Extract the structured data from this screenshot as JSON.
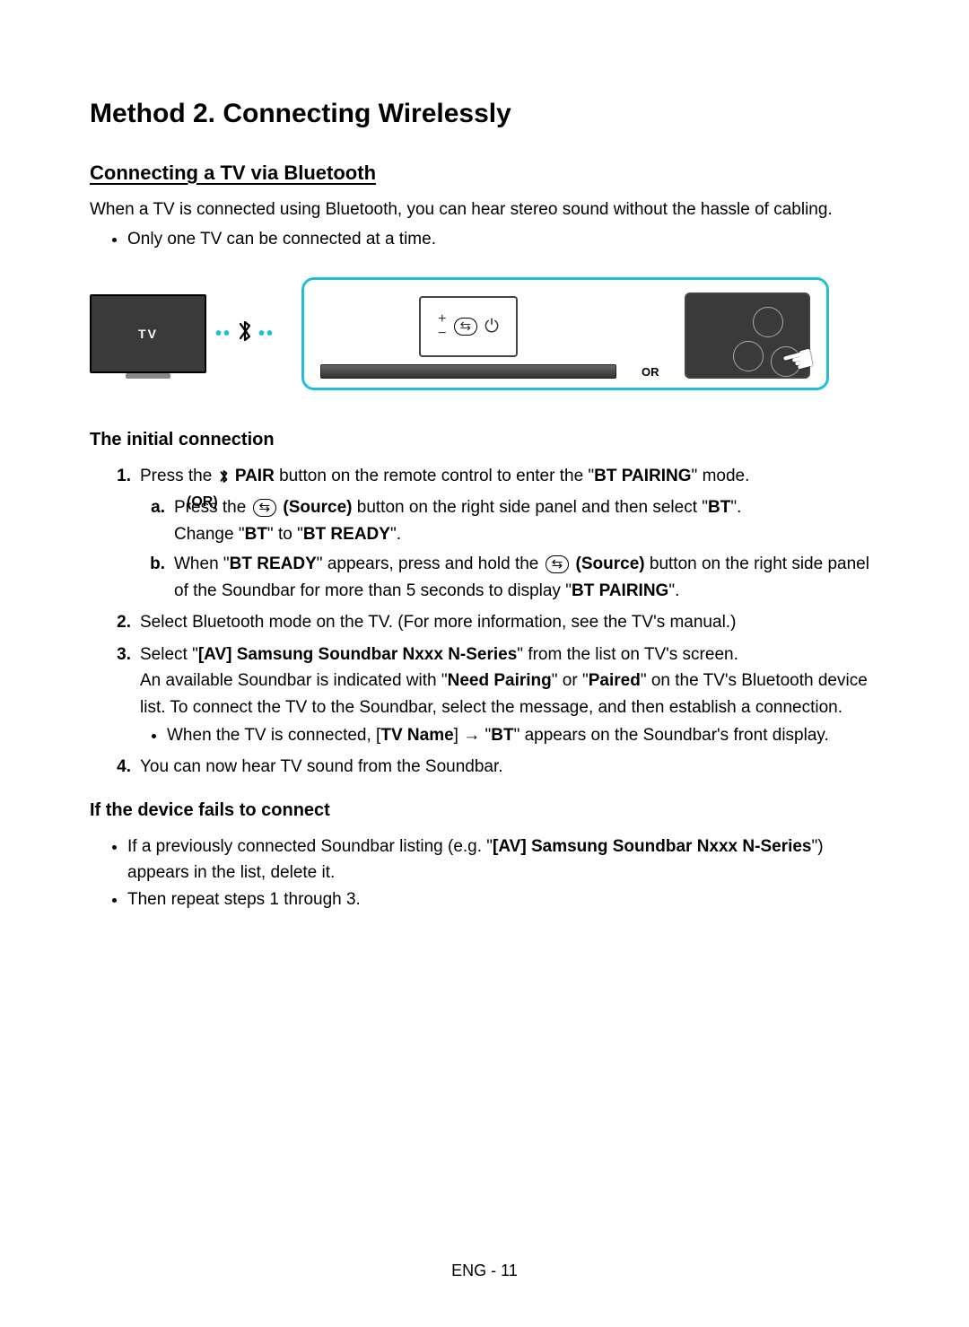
{
  "title": "Method 2. Connecting Wirelessly",
  "section": {
    "heading": "Connecting a TV via Bluetooth",
    "intro": "When a TV is connected using Bluetooth, you can hear stereo sound without the hassle of cabling.",
    "bullet": "Only one TV can be connected at a time."
  },
  "diagram": {
    "tv_label": "TV",
    "or_label": "OR",
    "panel_plus": "+",
    "panel_minus": "−",
    "panel_power": "⏻"
  },
  "initial": {
    "heading": "The initial connection",
    "step1": {
      "num": "1.",
      "t1": "Press the ",
      "pair": "PAIR",
      "t2": " button on the remote control to enter the \"",
      "bt_pairing": "BT PAIRING",
      "t3": "\" mode."
    },
    "or_label": "(OR)",
    "a": {
      "num": "a.",
      "t1": "Press the ",
      "source": "(Source)",
      "t2": " button on the right side panel and then select \"",
      "bt": "BT",
      "t3": "\".",
      "t4": "Change \"",
      "bt2": "BT",
      "t5": "\" to \"",
      "bt_ready": "BT READY",
      "t6": "\"."
    },
    "b": {
      "num": "b.",
      "t1": "When \"",
      "bt_ready": "BT READY",
      "t2": "\" appears, press and hold the ",
      "source": "(Source)",
      "t3": " button on the right side panel of the Soundbar for more than 5 seconds to display \"",
      "bt_pairing": "BT PAIRING",
      "t4": "\"."
    },
    "step2": {
      "num": "2.",
      "text": "Select Bluetooth mode on the TV. (For more information, see the TV's manual.)"
    },
    "step3": {
      "num": "3.",
      "t1": "Select \"",
      "device": "[AV] Samsung Soundbar Nxxx N-Series",
      "t2": "\" from the list on TV's screen.",
      "t3": "An available Soundbar is indicated with \"",
      "need": "Need Pairing",
      "t4": "\" or \"",
      "paired": "Paired",
      "t5": "\" on the TV's Bluetooth device list. To connect the TV to the Soundbar, select the message, and then establish a connection.",
      "sub_t1": "When the TV is connected, [",
      "tv_name": "TV Name",
      "sub_t2": "] → \"",
      "bt": "BT",
      "sub_t3": "\" appears on the Soundbar's front display."
    },
    "step4": {
      "num": "4.",
      "text": "You can now hear TV sound from the Soundbar."
    }
  },
  "fail": {
    "heading": "If the device fails to connect",
    "item1": {
      "t1": "If a previously connected Soundbar listing (e.g. \"",
      "device": "[AV] Samsung Soundbar Nxxx N-Series",
      "t2": "\") appears in the list, delete it."
    },
    "item2": "Then repeat steps 1 through 3."
  },
  "footer": "ENG - 11",
  "icons": {
    "bluetooth": "✱",
    "source": "⇆"
  }
}
